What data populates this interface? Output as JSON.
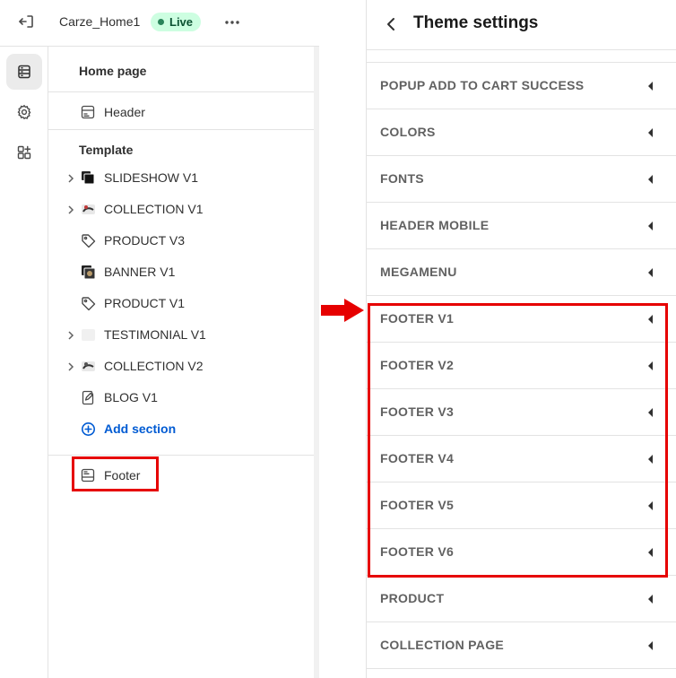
{
  "topbar": {
    "store_name": "Carze_Home1",
    "status_badge": "Live"
  },
  "rail": {
    "items": [
      "sections",
      "theme-settings",
      "app-embeds"
    ],
    "active": "sections"
  },
  "panel": {
    "title": "Home page",
    "header_label": "Header",
    "template_heading": "Template",
    "sections": [
      {
        "label": "SLIDESHOW V1",
        "icon": "stack-icon"
      },
      {
        "label": "COLLECTION V1",
        "icon": "collection-thumbnail-icon"
      },
      {
        "label": "PRODUCT V3",
        "icon": "tag-icon"
      },
      {
        "label": "BANNER V1",
        "icon": "banner-thumbnail-icon"
      },
      {
        "label": "PRODUCT V1",
        "icon": "tag-icon"
      },
      {
        "label": "TESTIMONIAL V1",
        "icon": "blank-thumbnail-icon"
      },
      {
        "label": "COLLECTION V2",
        "icon": "collection-thumbnail-icon"
      },
      {
        "label": "BLOG V1",
        "icon": "blog-icon"
      }
    ],
    "add_section_label": "Add section",
    "footer_label": "Footer"
  },
  "settings": {
    "title": "Theme settings",
    "items": [
      "POPUP ADD TO CART SUCCESS",
      "COLORS",
      "FONTS",
      "HEADER MOBILE",
      "MEGAMENU",
      "FOOTER V1",
      "FOOTER V2",
      "FOOTER V3",
      "FOOTER V4",
      "FOOTER V5",
      "FOOTER V6",
      "PRODUCT",
      "COLLECTION PAGE"
    ]
  },
  "colors": {
    "highlight": "#e60000",
    "live_badge_bg": "#cdfee1",
    "link": "#005bd3"
  }
}
